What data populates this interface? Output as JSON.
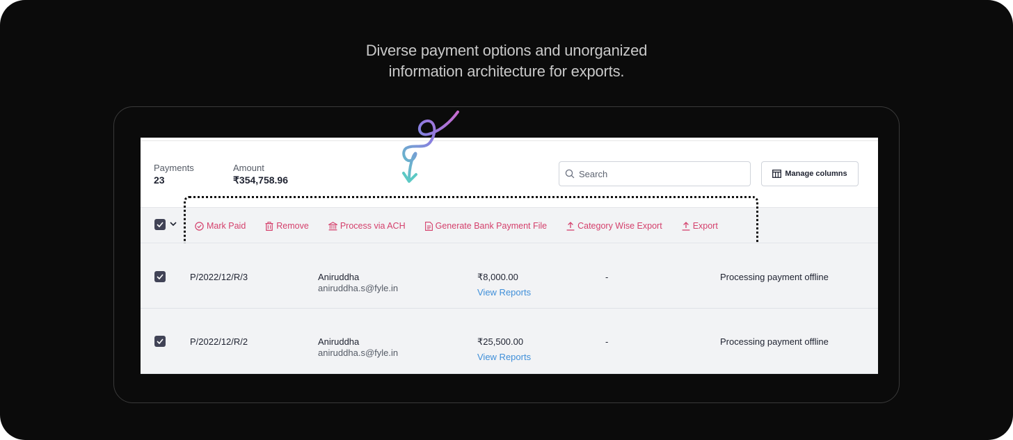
{
  "headline": {
    "line1": "Diverse payment options and unorganized",
    "line2": "information architecture for exports."
  },
  "summary": {
    "payments_label": "Payments",
    "payments_value": "23",
    "amount_label": "Amount",
    "amount_value": "₹354,758.96"
  },
  "search": {
    "placeholder": "Search",
    "value": ""
  },
  "manage_columns": {
    "label": "Manage columns"
  },
  "actions": [
    {
      "label": "Mark Paid",
      "icon": "check-circle-icon"
    },
    {
      "label": "Remove",
      "icon": "trash-icon"
    },
    {
      "label": "Process via ACH",
      "icon": "bank-icon"
    },
    {
      "label": "Generate Bank Payment File",
      "icon": "document-icon"
    },
    {
      "label": "Category Wise Export",
      "icon": "upload-icon"
    },
    {
      "label": "Export",
      "icon": "upload-icon"
    }
  ],
  "rows": [
    {
      "id": "P/2022/12/R/3",
      "name": "Aniruddha",
      "email": "aniruddha.s@fyle.in",
      "amount": "₹8,000.00",
      "link": "View Reports",
      "dash": "-",
      "status": "Processing payment offline"
    },
    {
      "id": "P/2022/12/R/2",
      "name": "Aniruddha",
      "email": "aniruddha.s@fyle.in",
      "amount": "₹25,500.00",
      "link": "View Reports",
      "dash": "-",
      "status": "Processing payment offline"
    }
  ],
  "colors": {
    "background": "#0b0b0b",
    "action_accent": "#d43f6b",
    "link": "#3f8fd9",
    "checkbox": "#414356",
    "row_bg": "#f2f3f5"
  }
}
